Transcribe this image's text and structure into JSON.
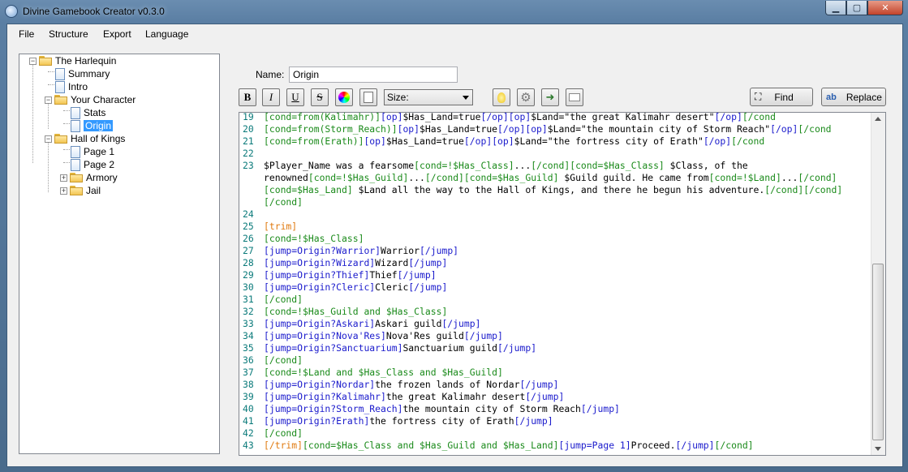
{
  "window": {
    "title": "Divine Gamebook Creator v0.3.0"
  },
  "menu": {
    "file": "File",
    "structure": "Structure",
    "export": "Export",
    "language": "Language"
  },
  "tree": {
    "root": "The Harlequin",
    "summary": "Summary",
    "intro": "Intro",
    "your_character": "Your Character",
    "stats": "Stats",
    "origin": "Origin",
    "hall_of_kings": "Hall of Kings",
    "page1": "Page 1",
    "page2": "Page 2",
    "armory": "Armory",
    "jail": "Jail"
  },
  "name_field": {
    "label": "Name:",
    "value": "Origin"
  },
  "toolbar": {
    "bold": "B",
    "italic": "I",
    "underline": "U",
    "strike": "S",
    "size_placeholder": "Size:",
    "find": "Find",
    "replace": "Replace"
  },
  "code_lines": [
    {
      "n": "19",
      "segs": [
        [
          "g",
          "[cond=from(Kalimahr)]"
        ],
        [
          "b",
          "[op]"
        ],
        [
          "k",
          "$Has_Land=true"
        ],
        [
          "b",
          "[/op][op]"
        ],
        [
          "k",
          "$Land=\"the great Kalimahr desert\""
        ],
        [
          "b",
          "[/op]"
        ],
        [
          "g",
          "[/cond"
        ]
      ]
    },
    {
      "n": "20",
      "segs": [
        [
          "g",
          "[cond=from(Storm_Reach)]"
        ],
        [
          "b",
          "[op]"
        ],
        [
          "k",
          "$Has_Land=true"
        ],
        [
          "b",
          "[/op][op]"
        ],
        [
          "k",
          "$Land=\"the mountain city of Storm Reach\""
        ],
        [
          "b",
          "[/op]"
        ],
        [
          "g",
          "[/cond"
        ]
      ]
    },
    {
      "n": "21",
      "segs": [
        [
          "g",
          "[cond=from(Erath)]"
        ],
        [
          "b",
          "[op]"
        ],
        [
          "k",
          "$Has_Land=true"
        ],
        [
          "b",
          "[/op][op]"
        ],
        [
          "k",
          "$Land=\"the fortress city of Erath\""
        ],
        [
          "b",
          "[/op]"
        ],
        [
          "g",
          "[/cond"
        ]
      ]
    },
    {
      "n": "22",
      "segs": []
    },
    {
      "n": "23",
      "segs": [
        [
          "k",
          "$Player_Name was a fearsome"
        ],
        [
          "g",
          "[cond=!$Has_Class]"
        ],
        [
          "k",
          "..."
        ],
        [
          "g",
          "[/cond][cond=$Has_Class]"
        ],
        [
          "k",
          " $Class, of the"
        ]
      ]
    },
    {
      "n": "",
      "segs": [
        [
          "k",
          "renowned"
        ],
        [
          "g",
          "[cond=!$Has_Guild]"
        ],
        [
          "k",
          "..."
        ],
        [
          "g",
          "[/cond][cond=$Has_Guild]"
        ],
        [
          "k",
          " $Guild guild. He came from"
        ],
        [
          "g",
          "[cond=!$Land]"
        ],
        [
          "k",
          "..."
        ],
        [
          "g",
          "[/cond]"
        ]
      ]
    },
    {
      "n": "",
      "segs": [
        [
          "g",
          "[cond=$Has_Land]"
        ],
        [
          "k",
          " $Land all the way to the Hall of Kings, and there he begun his adventure."
        ],
        [
          "g",
          "[/cond][/cond]"
        ]
      ]
    },
    {
      "n": "",
      "segs": [
        [
          "g",
          "[/cond]"
        ]
      ]
    },
    {
      "n": "24",
      "segs": []
    },
    {
      "n": "25",
      "segs": [
        [
          "o",
          "[trim]"
        ]
      ]
    },
    {
      "n": "26",
      "segs": [
        [
          "g",
          "[cond=!$Has_Class]"
        ]
      ]
    },
    {
      "n": "27",
      "segs": [
        [
          "b",
          "[jump=Origin?Warrior]"
        ],
        [
          "k",
          "Warrior"
        ],
        [
          "b",
          "[/jump]"
        ]
      ]
    },
    {
      "n": "28",
      "segs": [
        [
          "b",
          "[jump=Origin?Wizard]"
        ],
        [
          "k",
          "Wizard"
        ],
        [
          "b",
          "[/jump]"
        ]
      ]
    },
    {
      "n": "29",
      "segs": [
        [
          "b",
          "[jump=Origin?Thief]"
        ],
        [
          "k",
          "Thief"
        ],
        [
          "b",
          "[/jump]"
        ]
      ]
    },
    {
      "n": "30",
      "segs": [
        [
          "b",
          "[jump=Origin?Cleric]"
        ],
        [
          "k",
          "Cleric"
        ],
        [
          "b",
          "[/jump]"
        ]
      ]
    },
    {
      "n": "31",
      "segs": [
        [
          "g",
          "[/cond]"
        ]
      ]
    },
    {
      "n": "32",
      "segs": [
        [
          "g",
          "[cond=!$Has_Guild and $Has_Class]"
        ]
      ]
    },
    {
      "n": "33",
      "segs": [
        [
          "b",
          "[jump=Origin?Askari]"
        ],
        [
          "k",
          "Askari guild"
        ],
        [
          "b",
          "[/jump]"
        ]
      ]
    },
    {
      "n": "34",
      "segs": [
        [
          "b",
          "[jump=Origin?Nova'Res]"
        ],
        [
          "k",
          "Nova'Res guild"
        ],
        [
          "b",
          "[/jump]"
        ]
      ]
    },
    {
      "n": "35",
      "segs": [
        [
          "b",
          "[jump=Origin?Sanctuarium]"
        ],
        [
          "k",
          "Sanctuarium guild"
        ],
        [
          "b",
          "[/jump]"
        ]
      ]
    },
    {
      "n": "36",
      "segs": [
        [
          "g",
          "[/cond]"
        ]
      ]
    },
    {
      "n": "37",
      "segs": [
        [
          "g",
          "[cond=!$Land and $Has_Class and $Has_Guild]"
        ]
      ]
    },
    {
      "n": "38",
      "segs": [
        [
          "b",
          "[jump=Origin?Nordar]"
        ],
        [
          "k",
          "the frozen lands of Nordar"
        ],
        [
          "b",
          "[/jump]"
        ]
      ]
    },
    {
      "n": "39",
      "segs": [
        [
          "b",
          "[jump=Origin?Kalimahr]"
        ],
        [
          "k",
          "the great Kalimahr desert"
        ],
        [
          "b",
          "[/jump]"
        ]
      ]
    },
    {
      "n": "40",
      "segs": [
        [
          "b",
          "[jump=Origin?Storm_Reach]"
        ],
        [
          "k",
          "the mountain city of Storm Reach"
        ],
        [
          "b",
          "[/jump]"
        ]
      ]
    },
    {
      "n": "41",
      "segs": [
        [
          "b",
          "[jump=Origin?Erath]"
        ],
        [
          "k",
          "the fortress city of Erath"
        ],
        [
          "b",
          "[/jump]"
        ]
      ]
    },
    {
      "n": "42",
      "segs": [
        [
          "g",
          "[/cond]"
        ]
      ]
    },
    {
      "n": "43",
      "segs": [
        [
          "o",
          "[/trim]"
        ],
        [
          "g",
          "[cond=$Has_Class and $Has_Guild and $Has_Land]"
        ],
        [
          "b",
          "[jump=Page 1]"
        ],
        [
          "k",
          "Proceed."
        ],
        [
          "b",
          "[/jump]"
        ],
        [
          "g",
          "[/cond]"
        ]
      ]
    }
  ]
}
